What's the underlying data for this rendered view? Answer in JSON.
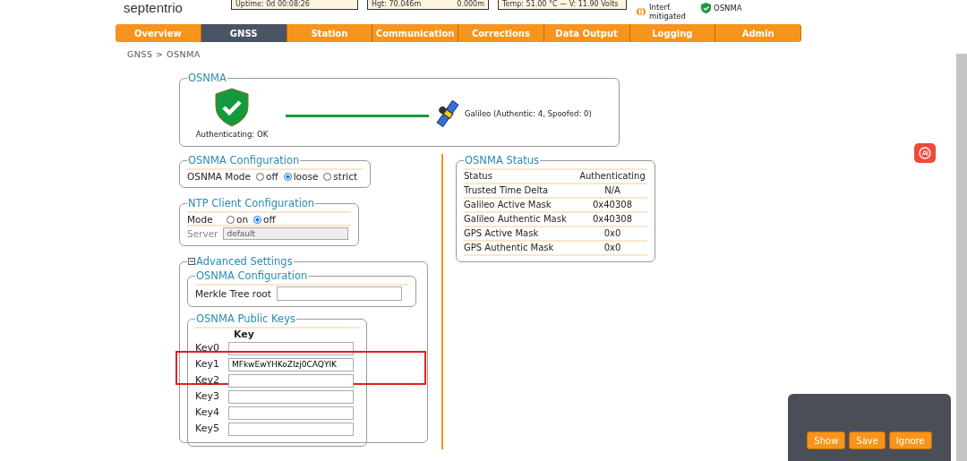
{
  "header": {
    "logo": "septentrio",
    "status_boxes": [
      {
        "texts": [
          "Uptime: 0d 00:08:26"
        ]
      },
      {
        "texts": [
          "Hgt: 70.046m",
          "0.000m"
        ]
      },
      {
        "texts": [
          "Temp: 51.00 °C — V: 11.90 Volts"
        ]
      }
    ],
    "indicators": [
      {
        "kind": "interference",
        "label": "Interf. mitigated"
      },
      {
        "kind": "shield",
        "label": "OSNMA"
      }
    ]
  },
  "nav": [
    {
      "label": "Overview",
      "selected": false
    },
    {
      "label": "GNSS",
      "selected": true
    },
    {
      "label": "Station",
      "selected": false
    },
    {
      "label": "Communication",
      "selected": false
    },
    {
      "label": "Corrections",
      "selected": false
    },
    {
      "label": "Data Output",
      "selected": false
    },
    {
      "label": "Logging",
      "selected": false
    },
    {
      "label": "Admin",
      "selected": false
    }
  ],
  "breadcrumb": "GNSS > OSNMA",
  "osnma_overview": {
    "title": "OSNMA",
    "status_label": "Authenticating: OK",
    "constellation": "Galileo (Authentic: 4, Spoofed: 0)"
  },
  "osnma_config": {
    "title": "OSNMA Configuration",
    "mode_label": "OSNMA Mode",
    "options": [
      {
        "label": "off",
        "selected": false
      },
      {
        "label": "loose",
        "selected": true
      },
      {
        "label": "strict",
        "selected": false
      }
    ]
  },
  "ntp": {
    "title": "NTP Client Configuration",
    "mode_label": "Mode",
    "options": [
      {
        "label": "on",
        "selected": false
      },
      {
        "label": "off",
        "selected": true
      }
    ],
    "server_label": "Server",
    "server_value": "default",
    "server_disabled": true
  },
  "advanced": {
    "title": "Advanced Settings",
    "expanded": true,
    "config": {
      "title": "OSNMA Configuration",
      "merkle_label": "Merkle Tree root"
    },
    "public_keys": {
      "title": "OSNMA Public Keys",
      "column": "Key",
      "keys": [
        {
          "label": "Key0",
          "highlighted": false
        },
        {
          "label": "Key1",
          "value": "MFkwEwYHKoZIzj0CAQYIK",
          "highlighted": true
        },
        {
          "label": "Key2",
          "highlighted": false
        },
        {
          "label": "Key3",
          "highlighted": false
        },
        {
          "label": "Key4",
          "highlighted": false
        },
        {
          "label": "Key5",
          "highlighted": false
        }
      ]
    }
  },
  "osnma_status": {
    "title": "OSNMA Status",
    "rows": [
      {
        "label": "Status",
        "value": "Authenticating"
      },
      {
        "label": "Trusted Time Delta",
        "value": "N/A"
      },
      {
        "label": "Galileo Active Mask",
        "value": "0x40308"
      },
      {
        "label": "Galileo Authentic Mask",
        "value": "0x40308"
      },
      {
        "label": "GPS Active Mask",
        "value": "0x0"
      },
      {
        "label": "GPS Authentic Mask",
        "value": "0x0"
      }
    ]
  },
  "popup": {
    "buttons": [
      "Show",
      "Save",
      "Ignore"
    ]
  }
}
